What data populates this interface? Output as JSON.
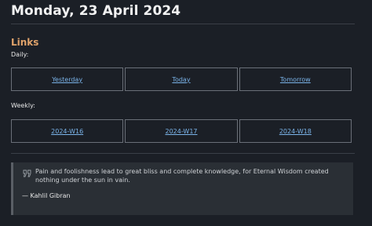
{
  "page": {
    "title": "Monday, 23 April 2024"
  },
  "links": {
    "heading": "Links",
    "daily_label": "Daily:",
    "daily": [
      "Yesterday",
      "Today",
      "Tomorrow"
    ],
    "weekly_label": "Weekly:",
    "weekly": [
      "2024-W16",
      "2024-W17",
      "2024-W18"
    ]
  },
  "quote": {
    "icon": "quote-icon",
    "text": "Pain and foolishness lead to great bliss and complete knowledge, for Eternal Wisdom created nothing under the sun in vain.",
    "author": "— Kahlil Gibran"
  },
  "colors": {
    "background": "#1b1f26",
    "heading_accent": "#e0a36b",
    "link": "#7ab3e8",
    "quote_background": "#2a2f35"
  }
}
